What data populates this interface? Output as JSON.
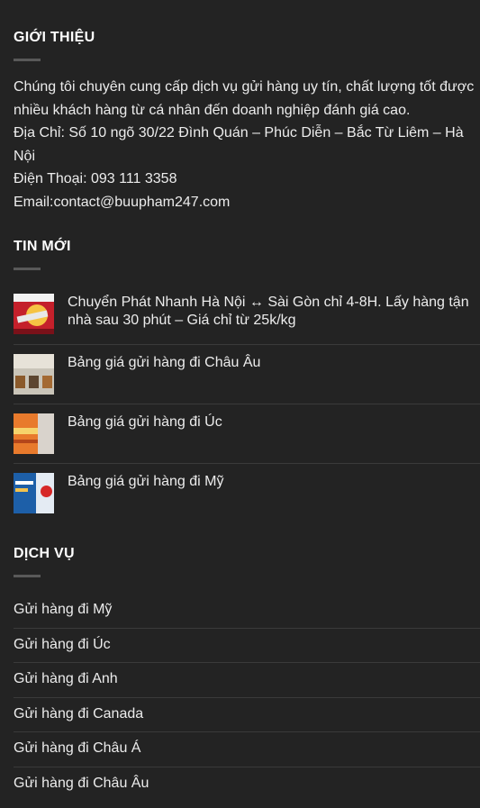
{
  "intro": {
    "title": "GIỚI THIỆU",
    "paragraph": "Chúng tôi chuyên cung cấp dịch vụ gửi hàng uy tín, chất lượng tốt được nhiều khách hàng từ cá nhân đến doanh nghiệp đánh giá cao.",
    "address": "Địa Chỉ: Số 10 ngõ 30/22 Đình Quán – Phúc Diễn – Bắc Từ Liêm – Hà Nội",
    "phone": "Điện Thoại: 093 111 3358",
    "email": "Email:contact@buupham247.com"
  },
  "news": {
    "title": "TIN MỚI",
    "items": [
      {
        "title": "Chuyển Phát Nhanh Hà Nội ↔ Sài Gòn chỉ 4-8H. Lấy hàng tận nhà sau 30 phút – Giá chỉ từ 25k/kg",
        "thumb_icon": "express-delivery-thumbnail"
      },
      {
        "title": "Bảng giá gửi hàng đi Châu Âu",
        "thumb_icon": "europe-shipping-thumbnail"
      },
      {
        "title": "Bảng giá gửi hàng đi Úc",
        "thumb_icon": "australia-shipping-thumbnail"
      },
      {
        "title": "Bảng giá gửi hàng đi Mỹ",
        "thumb_icon": "usa-shipping-thumbnail"
      }
    ]
  },
  "services": {
    "title": "DỊCH VỤ",
    "items": [
      "Gửi hàng đi Mỹ",
      "Gửi hàng đi Úc",
      "Gửi hàng đi Anh",
      "Gửi hàng đi Canada",
      "Gửi hàng đi Châu Á",
      "Gửi hàng đi Châu Âu"
    ]
  },
  "colors": {
    "background": "#232323",
    "text": "#ececec",
    "divider": "#595959"
  }
}
